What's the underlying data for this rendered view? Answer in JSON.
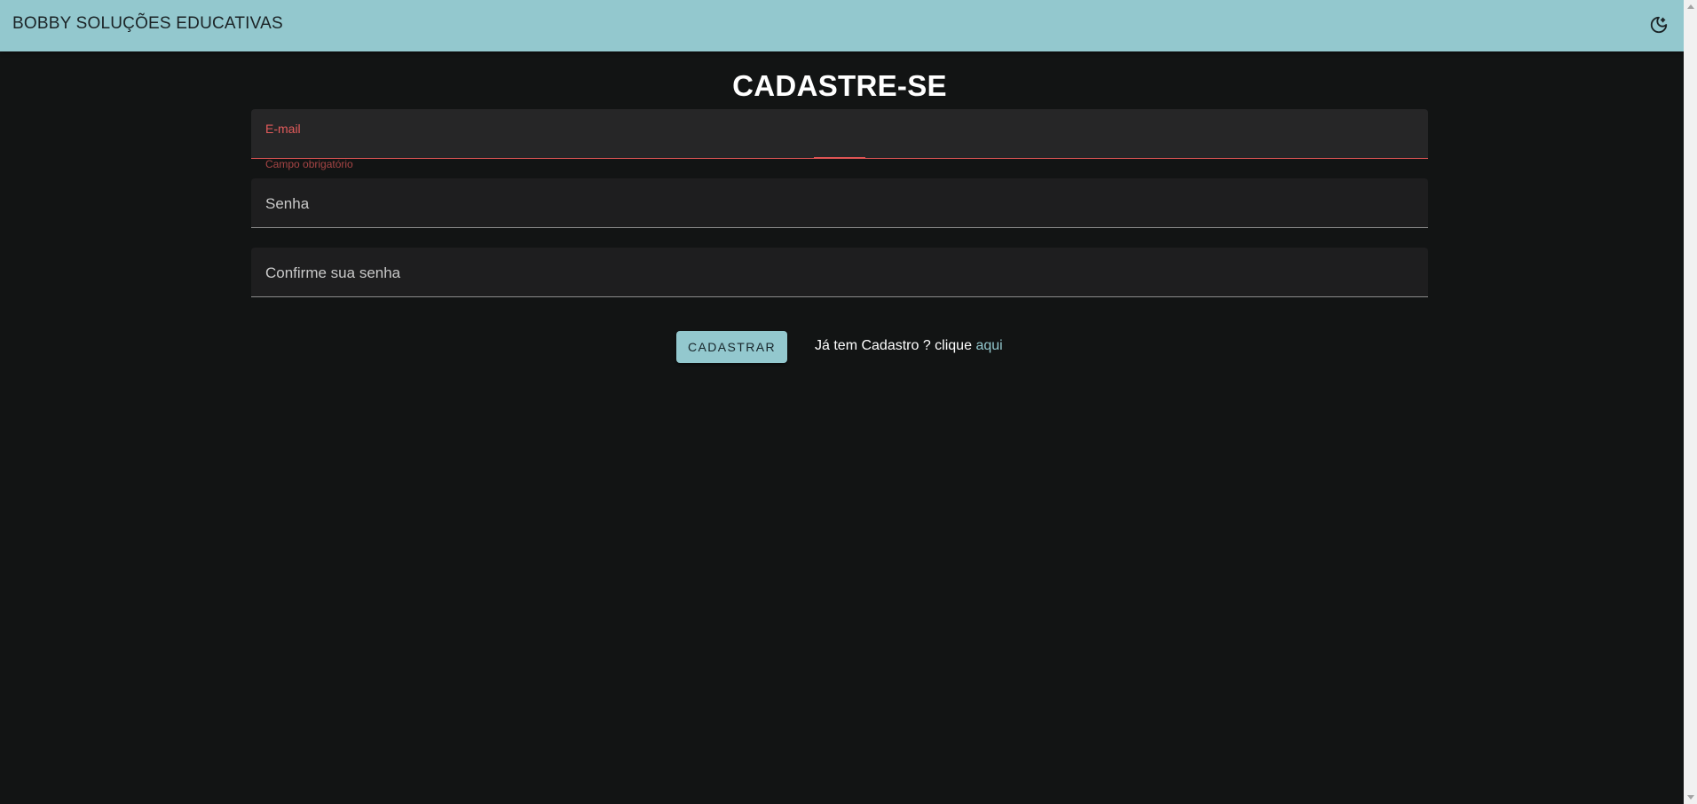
{
  "header": {
    "brand": "BOBBY SOLUÇÕES EDUCATIVAS",
    "theme_icon": "moon-stars-icon"
  },
  "form": {
    "title": "CADASTRE-SE",
    "email": {
      "label": "E-mail",
      "value": "",
      "helper": "Campo obrigatório"
    },
    "password": {
      "label": "Senha",
      "value": ""
    },
    "confirm_password": {
      "label": "Confirme sua senha",
      "value": ""
    },
    "submit_label": "CADASTRAR",
    "login_prompt": "Já tem Cadastro ? clique",
    "login_link": "aqui"
  },
  "colors": {
    "accent": "#93c8ce",
    "background": "#121414",
    "error": "#e05555"
  }
}
